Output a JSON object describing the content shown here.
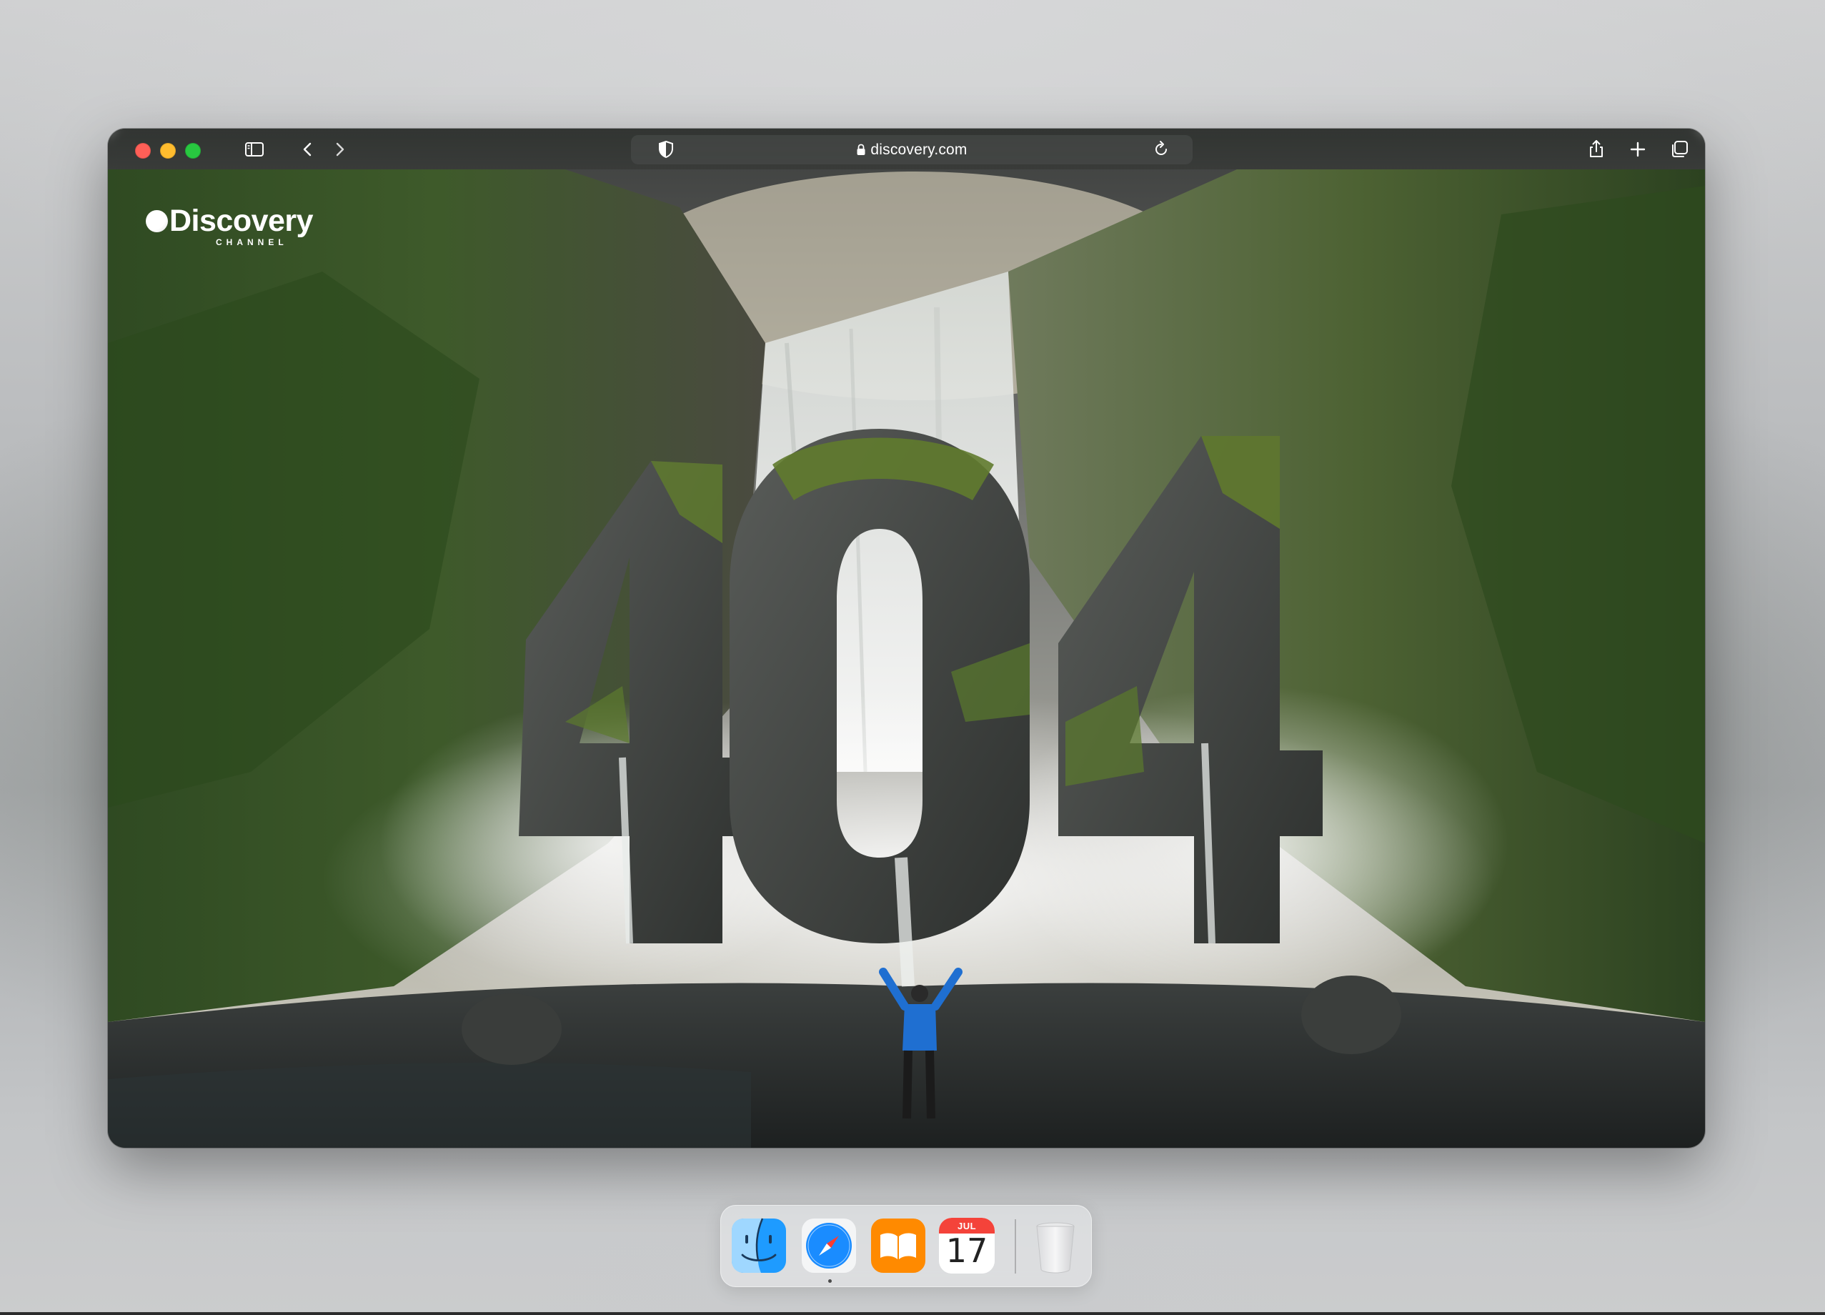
{
  "browser": {
    "url": "discovery.com",
    "traffic_lights": {
      "close": "#ff5f57",
      "minimize": "#febc2e",
      "zoom": "#28c840"
    },
    "icons": [
      "sidebar-icon",
      "back-icon",
      "forward-icon",
      "privacy-shield-icon",
      "lock-icon",
      "reload-icon",
      "share-icon",
      "new-tab-icon",
      "tab-overview-icon"
    ]
  },
  "page": {
    "logo": {
      "word": "Discovery",
      "sub": "CHANNEL"
    },
    "hero_text": "404"
  },
  "dock": {
    "apps": [
      {
        "name": "Finder",
        "icon": "finder-icon"
      },
      {
        "name": "Safari",
        "icon": "safari-icon",
        "running": true
      },
      {
        "name": "Books",
        "icon": "books-icon"
      },
      {
        "name": "Calendar",
        "icon": "calendar-icon",
        "month": "JUL",
        "day": "17"
      },
      {
        "name": "Trash",
        "icon": "trash-icon"
      }
    ]
  },
  "colors": {
    "books": "#ff8a00",
    "calendar_header": "#f4433a",
    "safari": "#1a8cff"
  }
}
